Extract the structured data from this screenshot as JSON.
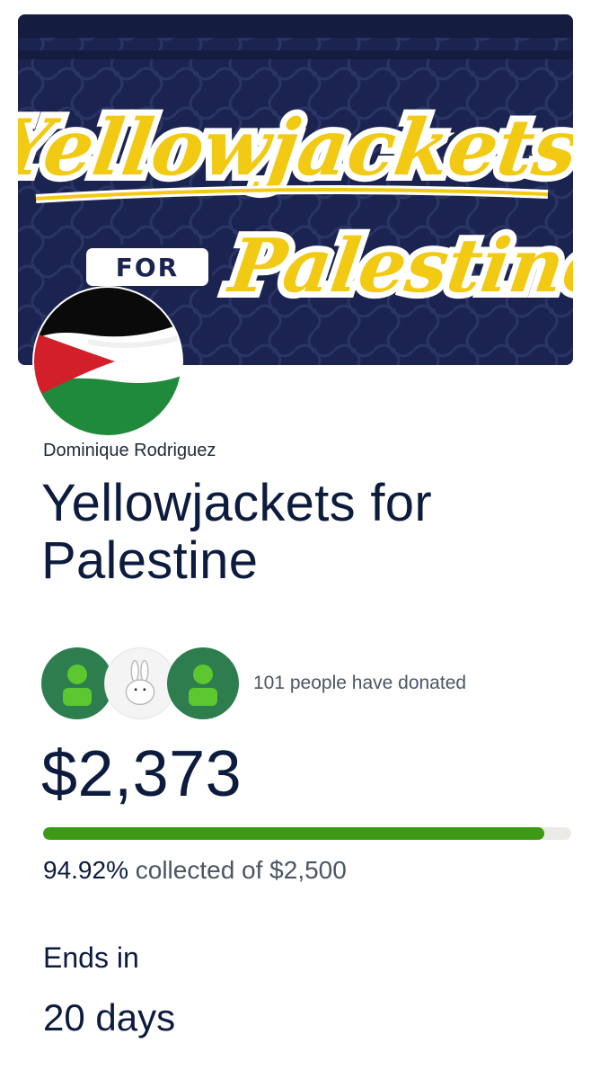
{
  "banner": {
    "line1": "Yellowjackets",
    "badge": "FOR",
    "line2": "Palestine"
  },
  "organizer": "Dominique Rodriguez",
  "title": "Yellowjackets for Palestine",
  "donors": {
    "count_text": "101 people have donated"
  },
  "raised": "$2,373",
  "progress": {
    "fraction": 0.9492
  },
  "stats": {
    "percent": "94.92%",
    "collected_text": "collected of $2,500"
  },
  "ends": {
    "label": "Ends in",
    "value": "20 days"
  },
  "colors": {
    "navy": "#1b2450",
    "yellow": "#f2c913",
    "progress_green": "#3d9a15",
    "donor_green": "#2e7d4f",
    "avatar_green": "#5cc72e",
    "flag_red": "#d21f2a",
    "flag_green": "#1f8a3c"
  }
}
